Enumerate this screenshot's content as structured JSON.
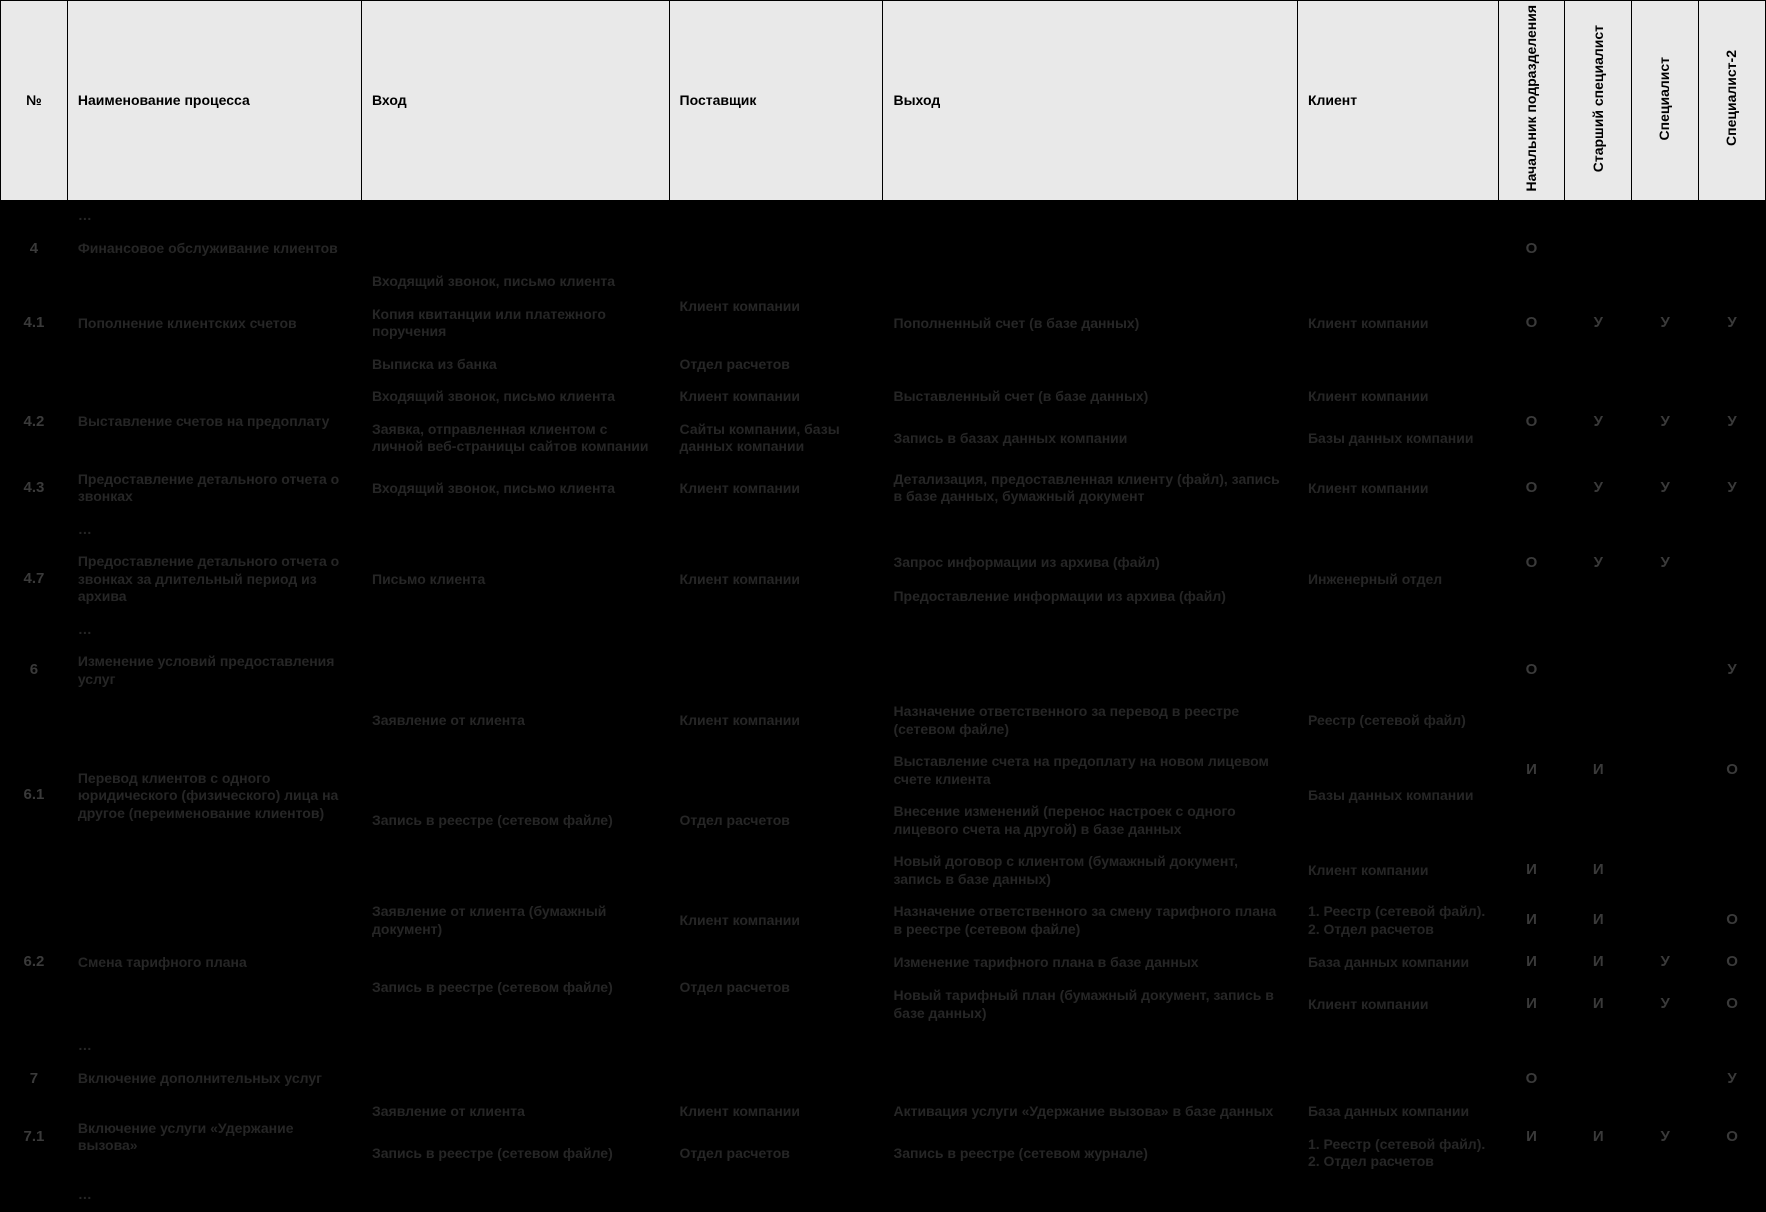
{
  "headers": {
    "num": "№",
    "name": "Наименование процесса",
    "input": "Вход",
    "supplier": "Поставщик",
    "output": "Выход",
    "client": "Клиент",
    "role1": "Начальник подразделения",
    "role2": "Старший специалист",
    "role3": "Специалист",
    "role4": "Специалист-2"
  },
  "dots": "…",
  "rows": {
    "r4": {
      "num": "4",
      "name": "Финансовое обслуживание клиентов",
      "r1": "О"
    },
    "r41_num": "4.1",
    "r41_name": "Пополнение клиентских счетов",
    "r41_in1": "Входящий звонок, письмо клиента",
    "r41_in2": "Копия квитанции или платежного поручения",
    "r41_in3": "Выписка из банка",
    "r41_sup12": "Клиент компании",
    "r41_sup3": "Отдел расчетов",
    "r41_out": "Пополненный счет (в базе данных)",
    "r41_cli": "Клиент компании",
    "r41_r1": "О",
    "r41_r2": "У",
    "r41_r3": "У",
    "r41_r4": "У",
    "r42_num": "4.2",
    "r42_name": "Выставление счетов на предоплату",
    "r42_in1": "Входящий звонок, письмо клиента",
    "r42_sup1": "Клиент компании",
    "r42_out1": "Выставленный счет (в базе данных)",
    "r42_cli1": "Клиент компании",
    "r42_in2": "Заявка, отправленная клиентом с личной веб-страницы сайтов компании",
    "r42_sup2": "Сайты компании, базы данных компании",
    "r42_out2": "Запись в базах данных компании",
    "r42_cli2": "Базы данных  компании",
    "r42_r1": "О",
    "r42_r2": "У",
    "r42_r3": "У",
    "r42_r4": "У",
    "r43_num": "4.3",
    "r43_name": "Предоставление детального отчета о звонках",
    "r43_in": "Входящий звонок, письмо клиента",
    "r43_sup": "Клиент компании",
    "r43_out": "Детализация, предоставленная клиенту (файл), запись в базе данных, бумажный документ",
    "r43_cli": "Клиент компании",
    "r43_r1": "О",
    "r43_r2": "У",
    "r43_r3": "У",
    "r43_r4": "У",
    "r47_num": "4.7",
    "r47_name": "Предоставление детального отчета о звонках за длительный период из архива",
    "r47_in": "Письмо клиента",
    "r47_sup": "Клиент компании",
    "r47_out1": "Запрос информации из архива (файл)",
    "r47_cli1": "Инженерный отдел",
    "r47_out2": "Предоставление информации из архива (файл)",
    "r47_r1": "О",
    "r47_r2": "У",
    "r47_r3": "У",
    "r6": {
      "num": "6",
      "name": "Изменение условий предоставления услуг",
      "r1": "О",
      "r4": "У"
    },
    "r61_num": "6.1",
    "r61_name": "Перевод клиентов с одного юридического (физического) лица на другое (переименование клиентов)",
    "r61_in1": "Заявление от клиента",
    "r61_sup1": "Клиент компании",
    "r61_out1": "Назначение ответственного за перевод в реестре (сетевом файле)",
    "r61_cli1": "Реестр (сетевой файл)",
    "r61_in234": "Запись в реестре (сетевом файле)",
    "r61_sup234": "Отдел расчетов",
    "r61_out2": "Выставление счета на предоплату на новом лицевом счете клиента",
    "r61_out3": "Внесение изменений (перенос настроек с одного лицевого счета на другой)  в базе данных",
    "r61_cli23": "Базы данных  компании",
    "r61_out4": "Новый договор с клиентом (бумажный документ, запись в базе данных)",
    "r61_cli4": "Клиент компании",
    "r61_r1a": "И",
    "r61_r2a": "И",
    "r61_r4a": "О",
    "r61_r1b": "И",
    "r61_r2b": "И",
    "r62_num": "6.2",
    "r62_name": "Смена тарифного плана",
    "r62_in1": "Заявление от клиента (бумажный документ)",
    "r62_sup1": "Клиент компании",
    "r62_out1": "Назначение ответственного за смену тарифного плана в реестре (сетевом файле)",
    "r62_cli1": "1. Реестр (сетевой файл). 2. Отдел расчетов",
    "r62a_r1": "И",
    "r62a_r2": "И",
    "r62a_r4": "О",
    "r62_in23": "Запись в реестре (сетевом файле)",
    "r62_sup23": "Отдел расчетов",
    "r62_out2": "Изменение тарифного плана  в базе данных",
    "r62_cli2": "База данных компании",
    "r62b_r1": "И",
    "r62b_r2": "И",
    "r62b_r3": "У",
    "r62b_r4": "О",
    "r62_out3": "Новый тарифный план (бумажный документ, запись в базе данных)",
    "r62_cli3": "Клиент компании",
    "r62c_r1": "И",
    "r62c_r2": "И",
    "r62c_r3": "У",
    "r62c_r4": "О",
    "r7": {
      "num": "7",
      "name": "Включение дополнительных услуг",
      "r1": "О",
      "r4": "У"
    },
    "r71_num": "7.1",
    "r71_name": "Включение услуги «Удержание вызова»",
    "r71_in1": "Заявление от клиента",
    "r71_sup1": "Клиент компании",
    "r71_out1": "Активация услуги «Удержание вызова» в базе данных",
    "r71_cli1": "База данных компании",
    "r71_in2": "Запись в реестре (сетевом файле)",
    "r71_sup2": "Отдел расчетов",
    "r71_out2": "Запись в реестре (сетевом журнале)",
    "r71_cli2": "1. Реестр (сетевой файл). 2. Отдел расчетов",
    "r71_r1": "И",
    "r71_r2": "И",
    "r71_r3": "У",
    "r71_r4": "О"
  }
}
